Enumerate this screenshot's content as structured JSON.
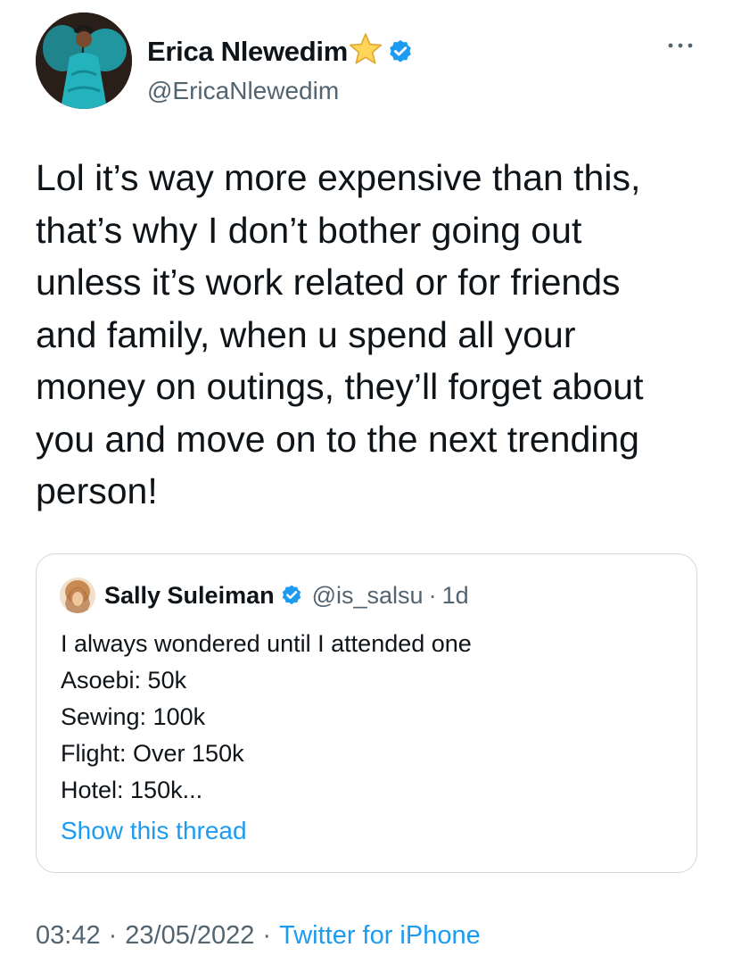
{
  "author": {
    "display_name": "Erica Nlewedim",
    "handle": "@EricaNlewedim",
    "name_emoji": "star-icon",
    "verified": true
  },
  "tweet": {
    "text": "Lol it’s way more expensive than this,\nthat’s why I don’t bother going out\nunless it’s work related or for friends\nand family, when u spend all your\nmoney on outings, they’ll forget about\nyou and move on to the next trending\nperson!"
  },
  "quote": {
    "display_name": "Sally Suleiman",
    "handle": "@is_salsu",
    "separator": "·",
    "time": "1d",
    "verified": true,
    "body": "I always wondered until I attended one\nAsoebi: 50k\nSewing: 100k\nFlight: Over 150k\nHotel: 150k...",
    "show_thread_label": "Show this thread"
  },
  "footer": {
    "time": "03:42",
    "date": "23/05/2022",
    "source": "Twitter for iPhone",
    "separator": "·"
  },
  "colors": {
    "text_primary": "#0f1419",
    "text_secondary": "#536471",
    "accent": "#1d9bf0",
    "border": "#cfd9de"
  }
}
